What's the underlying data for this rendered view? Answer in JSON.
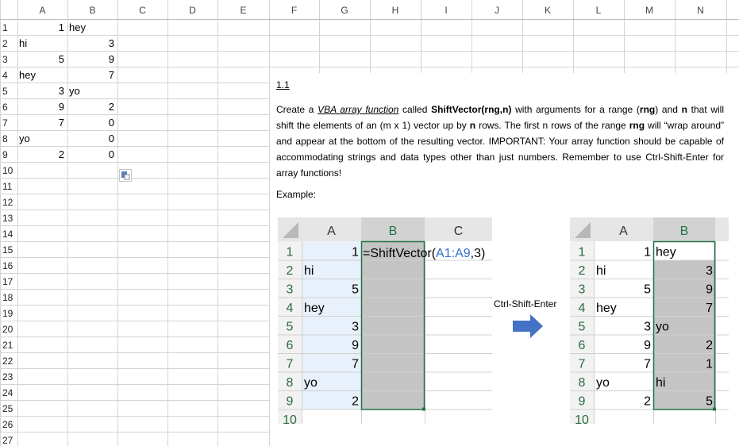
{
  "sheet": {
    "columns": [
      "A",
      "B",
      "C",
      "D",
      "E",
      "F",
      "G",
      "H",
      "I",
      "J",
      "K",
      "L",
      "M",
      "N"
    ],
    "row_numbers": [
      1,
      2,
      3,
      4,
      5,
      6,
      7,
      8,
      9,
      10,
      11,
      12,
      13,
      14,
      15,
      16,
      17,
      18,
      19,
      20,
      21,
      22,
      23,
      24,
      25,
      26,
      27
    ],
    "col_a": [
      "1",
      "hi",
      "5",
      "hey",
      "3",
      "9",
      "7",
      "yo",
      "2"
    ],
    "col_b": [
      "hey",
      "3",
      "9",
      "7",
      "yo",
      "2",
      "0",
      "0",
      "0"
    ]
  },
  "textbox": {
    "heading": "1.1",
    "para": {
      "p1": "Create a ",
      "link": "VBA array function",
      "p2": " called ",
      "fn": "ShiftVector(rng,n)",
      "p3": " with arguments for a range (",
      "rng1": "rng",
      "p4": ") and ",
      "n1": "n",
      "p5": " that will shift the elements of an (m x 1) vector up by ",
      "n2": "n",
      "p6": " rows.  The first n rows of the range ",
      "rng2": "rng",
      "p7": " will “wrap around” and appear at the bottom of the resulting vector.  IMPORTANT: Your array function should be capable of accommodating strings and data types other than just numbers.  Remember to use Ctrl-Shift-Enter for array functions!"
    },
    "example_label": "Example:",
    "cse_label": "Ctrl-Shift-Enter",
    "arrow_icon": "right-arrow-icon",
    "left_example": {
      "columns": [
        "A",
        "B",
        "C"
      ],
      "rows": [
        "1",
        "2",
        "3",
        "4",
        "5",
        "6",
        "7",
        "8",
        "9",
        "10"
      ],
      "col_a": [
        "1",
        "hi",
        "5",
        "hey",
        "3",
        "9",
        "7",
        "yo",
        "2"
      ],
      "formula_prefix": "=ShiftVector(",
      "formula_ref": "A1:A9",
      "formula_suffix": ",3)"
    },
    "right_example": {
      "columns": [
        "A",
        "B"
      ],
      "rows": [
        "1",
        "2",
        "3",
        "4",
        "5",
        "6",
        "7",
        "8",
        "9",
        "10"
      ],
      "col_a": [
        "1",
        "hi",
        "5",
        "hey",
        "3",
        "9",
        "7",
        "yo",
        "2"
      ],
      "col_b": [
        "hey",
        "3",
        "9",
        "7",
        "yo",
        "2",
        "1",
        "hi",
        "5"
      ]
    }
  },
  "colors": {
    "grid": "#d4d4d4",
    "header_bg": "#ffffff",
    "header_text": "#444444",
    "selection_border": "#217346",
    "range_fill": "#e8f0fb",
    "array_fill": "#c4c4c4",
    "formula_ref": "#2f6fd0",
    "arrow": "#4472c4"
  }
}
